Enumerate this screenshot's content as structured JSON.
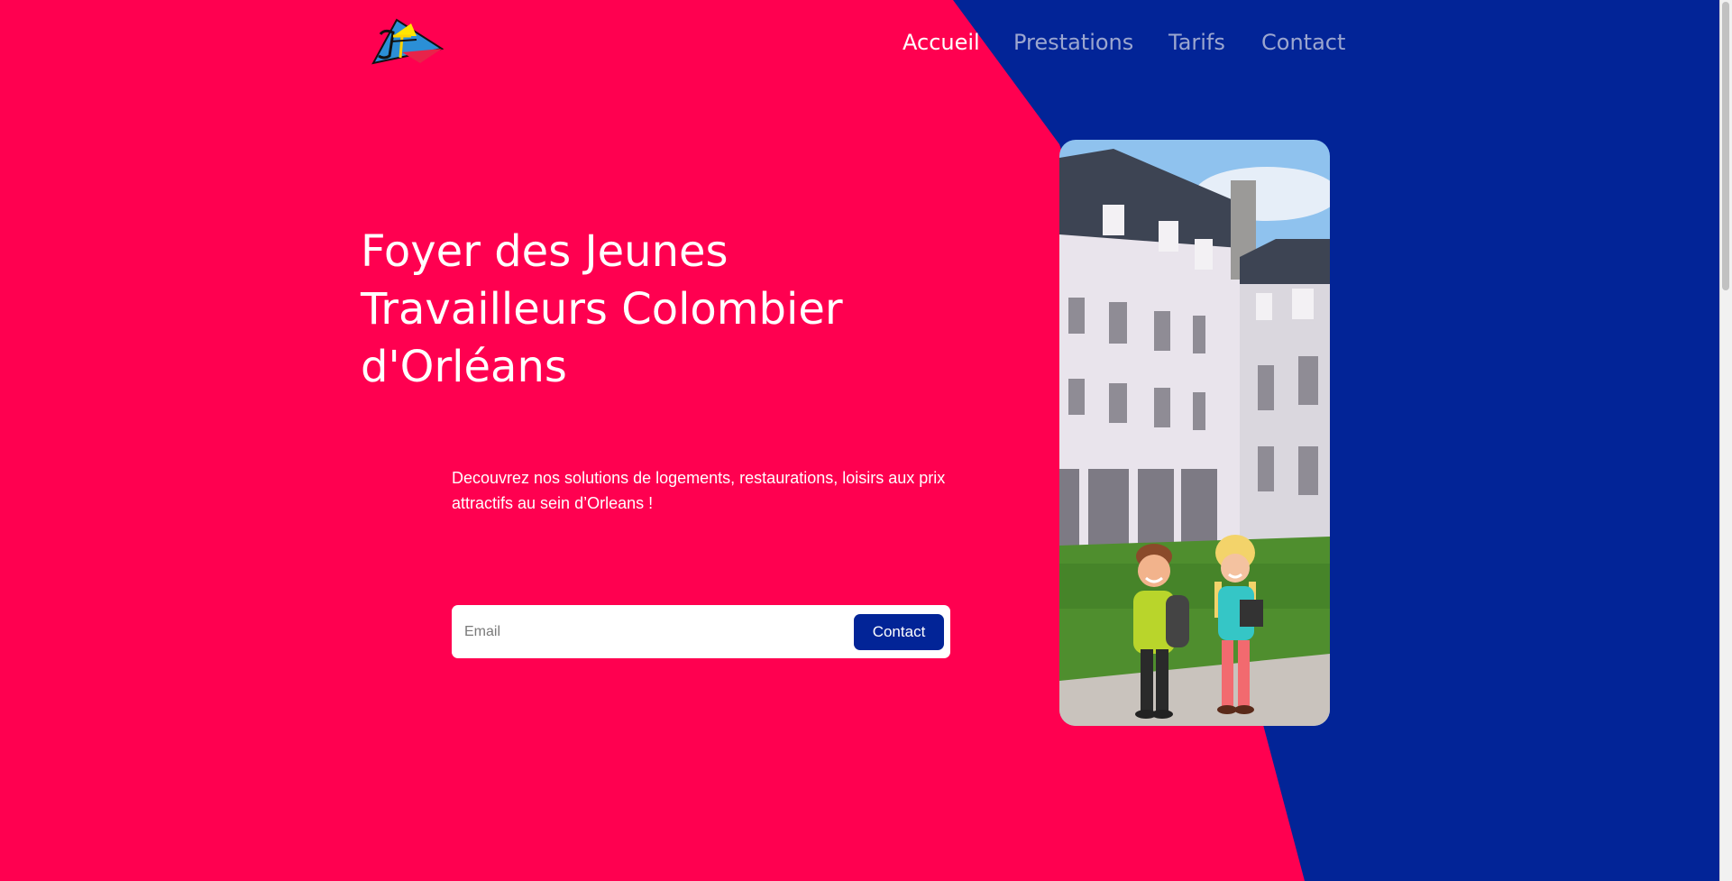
{
  "colors": {
    "brand_red": "#ff0050",
    "brand_blue": "#022497",
    "nav_inactive": "#9ba6cf",
    "text_light": "#ffffff"
  },
  "header": {
    "logo_icon": "fjt-triangle-logo",
    "nav": [
      {
        "label": "Accueil",
        "active": true
      },
      {
        "label": "Prestations",
        "active": false
      },
      {
        "label": "Tarifs",
        "active": false
      },
      {
        "label": "Contact",
        "active": false
      }
    ]
  },
  "hero": {
    "title_lines": [
      "Foyer des Jeunes",
      "Travailleurs Colombier",
      "d'Orléans"
    ],
    "tagline_lines": [
      "Decouvrez nos solutions de logements, restaurations, loisirs aux prix",
      "attractifs au sein d’Orleans !"
    ],
    "email_placeholder": "Email",
    "contact_button": "Contact",
    "photo_icon": "building-with-students-illustration"
  }
}
